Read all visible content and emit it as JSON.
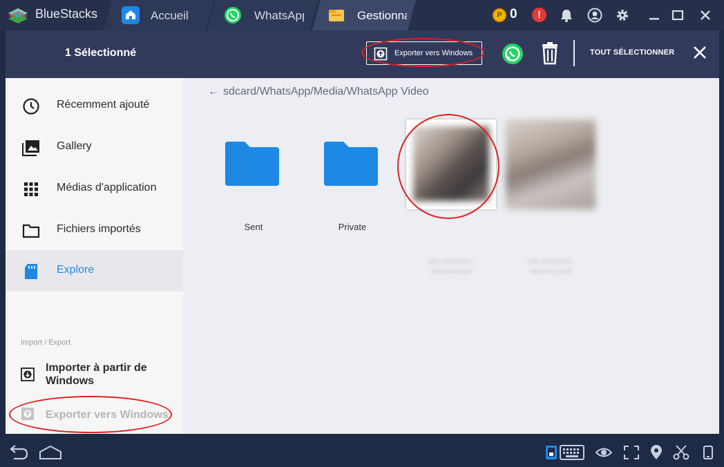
{
  "titlebar": {
    "brand": "BlueStacks",
    "tabs": [
      {
        "label": "Accueil",
        "icon": "home-icon"
      },
      {
        "label": "WhatsApp",
        "icon": "whatsapp-icon"
      },
      {
        "label": "Gestionna",
        "icon": "folder-icon"
      }
    ],
    "coin_count": "0",
    "alert_glyph": "!",
    "icons": [
      "coin-icon",
      "alert-icon",
      "bell-icon",
      "account-icon",
      "gear-icon",
      "minimize-icon",
      "maximize-icon",
      "close-icon"
    ]
  },
  "appbar": {
    "selection_label": "1 Sélectionné",
    "export_label": "Exporter vers Windows",
    "select_all_label": "TOUT SÉLECTIONNER",
    "icons": [
      "export-icon",
      "whatsapp-icon",
      "trash-icon",
      "close-icon"
    ]
  },
  "sidebar": {
    "items": [
      {
        "label": "Récemment ajouté",
        "icon": "clock-icon"
      },
      {
        "label": "Gallery",
        "icon": "photo-library-icon"
      },
      {
        "label": "Médias d'application",
        "icon": "apps-grid-icon"
      },
      {
        "label": "Fichiers importés",
        "icon": "folder-outline-icon"
      },
      {
        "label": "Explore",
        "icon": "sdcard-icon",
        "active": true
      }
    ],
    "section_header": "Import / Export",
    "import_label": "Importer à partir de Windows",
    "export_label": "Exporter vers Windows"
  },
  "main": {
    "path_arrow": "←",
    "path": "sdcard/WhatsApp/Media/WhatsApp Video",
    "folders": [
      {
        "name": "Sent"
      },
      {
        "name": "Private"
      }
    ],
    "videos": [
      {
        "caption_line1": "VID-20190601-",
        "caption_line2": "WA0000.mp4",
        "selected": true
      },
      {
        "caption_line1": "VID-20190601-",
        "caption_line2": "WA0001.mp4",
        "selected": false
      }
    ]
  },
  "colors": {
    "titlebar_bg": "#26304a",
    "appbar_bg": "#323a5c",
    "accent_blue": "#1e88e5",
    "folder_blue": "#1e88e5",
    "whatsapp_green": "#25d366",
    "annotation_red": "#e02020"
  },
  "bottombar": {
    "icons": [
      "back-icon",
      "home-outline-icon",
      "mobile-icon",
      "keyboard-icon",
      "eye-icon",
      "fullscreen-icon",
      "location-icon",
      "scissors-icon",
      "rotate-icon"
    ]
  }
}
